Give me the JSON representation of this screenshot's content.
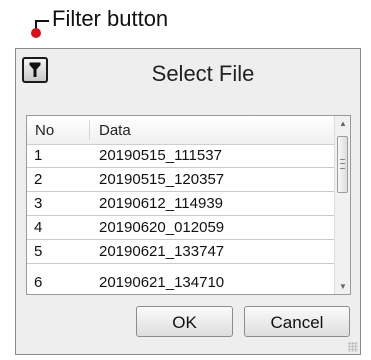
{
  "annotation": {
    "label": "Filter button"
  },
  "dialog": {
    "title": "Select File",
    "filter_icon": "filter-funnel-icon",
    "list": {
      "columns": [
        "No",
        "Data"
      ],
      "rows": [
        {
          "no": "1",
          "data": "20190515_111537"
        },
        {
          "no": "2",
          "data": "20190515_120357"
        },
        {
          "no": "3",
          "data": "20190612_114939"
        },
        {
          "no": "4",
          "data": "20190620_012059"
        },
        {
          "no": "5",
          "data": "20190621_133747"
        }
      ],
      "partial_row": {
        "no": "6",
        "data": "20190621_134710"
      }
    },
    "buttons": {
      "ok": "OK",
      "cancel": "Cancel"
    }
  },
  "colors": {
    "callout_dot": "#d8101c",
    "dialog_bg": "#eeeeee"
  }
}
